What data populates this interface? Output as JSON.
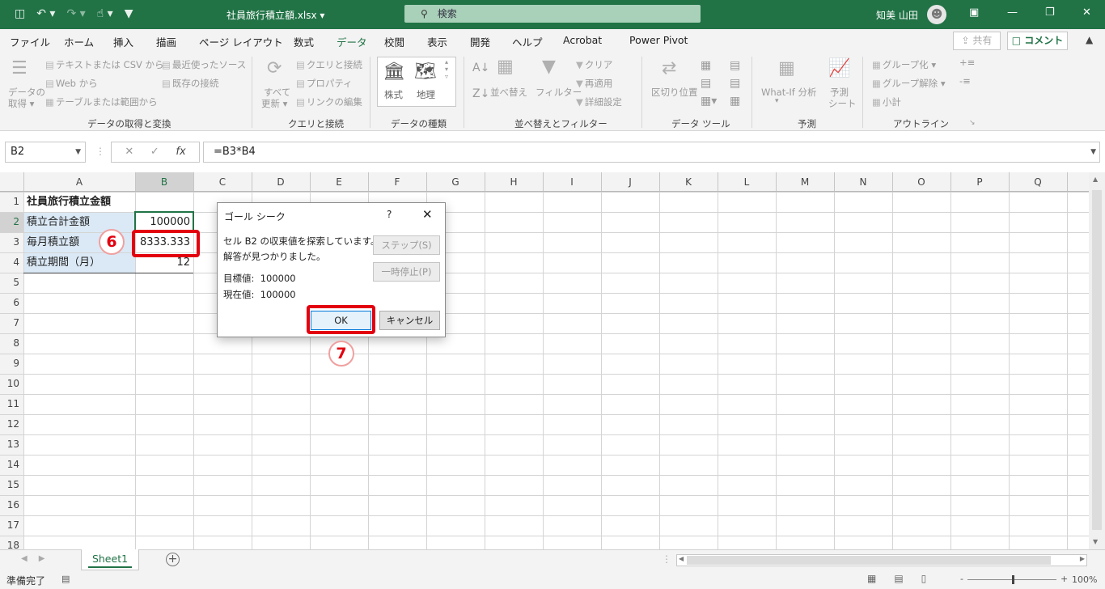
{
  "titlebar": {
    "filename": "社員旅行積立額.xlsx",
    "filename_suffix": " ▾",
    "search_placeholder": "検索",
    "user": "知美 山田",
    "accent": "#217346"
  },
  "tabs": [
    "ファイル",
    "ホーム",
    "挿入",
    "描画",
    "ページ レイアウト",
    "数式",
    "データ",
    "校閲",
    "表示",
    "開発",
    "ヘルプ",
    "Acrobat",
    "Power Pivot"
  ],
  "active_tab": "データ",
  "share_label": "共有",
  "comment_label": "コメント",
  "ribbon": {
    "get_data_1": "データの",
    "get_data_2": "取得",
    "text_csv": "テキストまたは CSV から",
    "web": "Web から",
    "table_range": "テーブルまたは範囲から",
    "recent_sources": "最近使ったソース",
    "existing_conn": "既存の接続",
    "group_get": "データの取得と変換",
    "refresh_1": "すべて",
    "refresh_2": "更新",
    "queries_conn": "クエリと接続",
    "properties": "プロパティ",
    "edit_links": "リンクの編集",
    "group_queries": "クエリと接続",
    "stocks": "株式",
    "geography": "地理",
    "group_datatypes": "データの種類",
    "sort": "並べ替え",
    "filter": "フィルター",
    "clear": "クリア",
    "reapply": "再適用",
    "advanced": "詳細設定",
    "group_sort": "並べ替えとフィルター",
    "text_to_columns": "区切り位置",
    "group_tools": "データ ツール",
    "whatif": "What-If 分析",
    "forecast_1": "予測",
    "forecast_2": "シート",
    "group_forecast": "予測",
    "group_btn": "グループ化",
    "ungroup": "グループ解除",
    "subtotal": "小計",
    "group_outline": "アウトライン"
  },
  "formula_bar": {
    "name_box": "B2",
    "formula": "=B3*B4"
  },
  "columns": [
    "A",
    "B",
    "C",
    "D",
    "E",
    "F",
    "G",
    "H",
    "I",
    "J",
    "K",
    "L",
    "M",
    "N",
    "O",
    "P",
    "Q"
  ],
  "rows": [
    "1",
    "2",
    "3",
    "4",
    "5",
    "6",
    "7",
    "8",
    "9",
    "10",
    "11",
    "12",
    "13",
    "14",
    "15",
    "16",
    "17",
    "18"
  ],
  "cells": {
    "A1": "社員旅行積立金額",
    "A2": "積立合計金額",
    "B2": "100000",
    "A3": "毎月積立額",
    "B3": "8333.333",
    "A4": "積立期間（月）",
    "B4": "12"
  },
  "dialog": {
    "title": "ゴール シーク",
    "help": "?",
    "line1": "セル B2 の収束値を探索しています。",
    "line2": "解答が見つかりました。",
    "target_label": "目標値:",
    "target_value": "100000",
    "current_label": "現在値:",
    "current_value": "100000",
    "step_button": "ステップ(S)",
    "pause_button": "一時停止(P)",
    "ok_button": "OK",
    "cancel_button": "キャンセル"
  },
  "annotations": {
    "step6": "6",
    "step7": "7",
    "highlight_color": "#e3000f"
  },
  "sheet_tab": "Sheet1",
  "status": {
    "ready": "準備完了",
    "zoom": "100%"
  }
}
